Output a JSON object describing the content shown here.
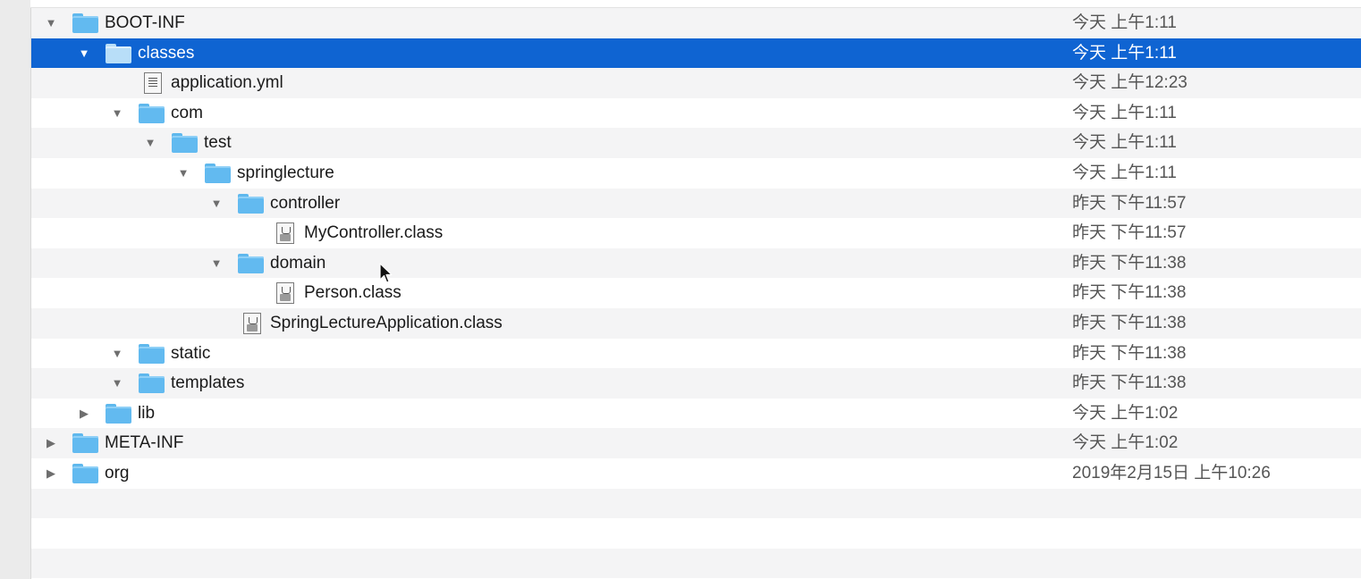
{
  "rows": [
    {
      "name": "BOOT-INF",
      "date": "今天 上午1:11",
      "type": "folder",
      "expanded": true
    },
    {
      "name": "classes",
      "date": "今天 上午1:11",
      "type": "folder",
      "expanded": true,
      "selected": true
    },
    {
      "name": "application.yml",
      "date": "今天 上午12:23",
      "type": "file"
    },
    {
      "name": "com",
      "date": "今天 上午1:11",
      "type": "folder",
      "expanded": true
    },
    {
      "name": "test",
      "date": "今天 上午1:11",
      "type": "folder",
      "expanded": true
    },
    {
      "name": "springlecture",
      "date": "今天 上午1:11",
      "type": "folder",
      "expanded": true
    },
    {
      "name": "controller",
      "date": "昨天 下午11:57",
      "type": "folder",
      "expanded": true
    },
    {
      "name": "MyController.class",
      "date": "昨天 下午11:57",
      "type": "class-file"
    },
    {
      "name": "domain",
      "date": "昨天 下午11:38",
      "type": "folder",
      "expanded": true
    },
    {
      "name": "Person.class",
      "date": "昨天 下午11:38",
      "type": "class-file"
    },
    {
      "name": "SpringLectureApplication.class",
      "date": "昨天 下午11:38",
      "type": "class-file"
    },
    {
      "name": "static",
      "date": "昨天 下午11:38",
      "type": "folder",
      "expanded": true
    },
    {
      "name": "templates",
      "date": "昨天 下午11:38",
      "type": "folder",
      "expanded": true
    },
    {
      "name": "lib",
      "date": "今天 上午1:02",
      "type": "folder",
      "expanded": false
    },
    {
      "name": "META-INF",
      "date": "今天 上午1:02",
      "type": "folder",
      "expanded": false
    },
    {
      "name": "org",
      "date": "2019年2月15日 上午10:26",
      "type": "folder",
      "expanded": false
    }
  ],
  "icons": {
    "expanded": "disclosure-expanded-icon",
    "collapsed": "disclosure-collapsed-icon",
    "folder": "folder-icon",
    "file": "document-icon",
    "class_file": "java-class-file-icon",
    "cursor": "mouse-pointer-icon"
  },
  "colors": {
    "selection": "#0f64d2",
    "folder": "#62baf0",
    "alt_row": "#f4f4f5",
    "date_text": "#555555"
  }
}
